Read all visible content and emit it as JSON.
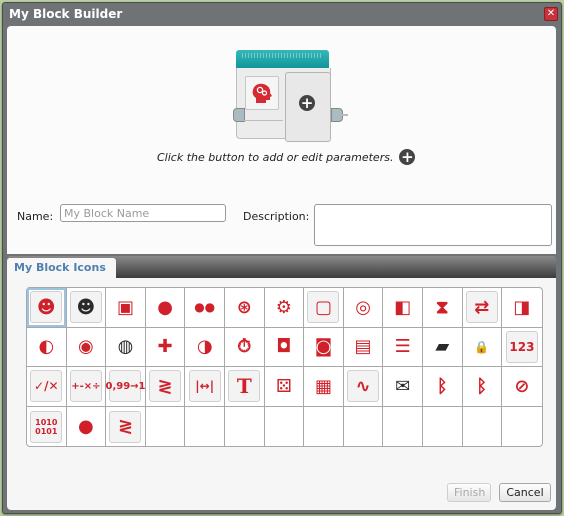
{
  "window": {
    "title": "My Block Builder",
    "close_icon": "close-icon"
  },
  "preview": {
    "instruction": "Click the button to add or edit parameters.",
    "add_icon": "+"
  },
  "form": {
    "name_label": "Name:",
    "name_value": "",
    "name_placeholder": "My Block Name",
    "description_label": "Description:",
    "description_value": ""
  },
  "tabs": [
    {
      "label": "My Block Icons",
      "active": true
    }
  ],
  "icon_grid": {
    "columns": 13,
    "rows": 4,
    "selected_index": 0,
    "icons": [
      {
        "name": "head-gears-red-icon",
        "glyph": "☻"
      },
      {
        "name": "head-gears-black-icon",
        "glyph": "☻"
      },
      {
        "name": "large-motor-icon",
        "glyph": "▣"
      },
      {
        "name": "medium-motor-icon",
        "glyph": "●"
      },
      {
        "name": "move-tank-icon",
        "glyph": "●●"
      },
      {
        "name": "move-steering-icon",
        "glyph": "⊛"
      },
      {
        "name": "motor-settings-icon",
        "glyph": "⚙"
      },
      {
        "name": "display-icon",
        "glyph": "▢"
      },
      {
        "name": "sound-icon",
        "glyph": "◎"
      },
      {
        "name": "brick-status-light-icon",
        "glyph": "◧"
      },
      {
        "name": "wait-hourglass-icon",
        "glyph": "⧗"
      },
      {
        "name": "loop-interrupt-icon",
        "glyph": "⇄"
      },
      {
        "name": "brick-port-icon",
        "glyph": "◨"
      },
      {
        "name": "color-sensor-icon",
        "glyph": "◐"
      },
      {
        "name": "gyro-sensor-icon",
        "glyph": "◉"
      },
      {
        "name": "infrared-sensor-icon",
        "glyph": "◍"
      },
      {
        "name": "brick-buttons-icon",
        "glyph": "✚"
      },
      {
        "name": "motor-rotation-icon",
        "glyph": "◑"
      },
      {
        "name": "timer-icon",
        "glyph": "⏱"
      },
      {
        "name": "touch-sensor-icon",
        "glyph": "◘"
      },
      {
        "name": "ultrasonic-sensor-icon",
        "glyph": "◙"
      },
      {
        "name": "energy-meter-icon",
        "glyph": "▤"
      },
      {
        "name": "file-access-icon",
        "glyph": "☰"
      },
      {
        "name": "case-icon",
        "glyph": "▰"
      },
      {
        "name": "locked-case-icon",
        "glyph": "🔒"
      },
      {
        "name": "array-icon",
        "glyph": "123"
      },
      {
        "name": "logic-operations-icon",
        "glyph": "✓/✕"
      },
      {
        "name": "math-icon",
        "glyph": "+-×÷"
      },
      {
        "name": "round-icon",
        "glyph": "0,99→1"
      },
      {
        "name": "compare-icon",
        "glyph": "≷"
      },
      {
        "name": "range-icon",
        "glyph": "|↔|"
      },
      {
        "name": "text-icon",
        "glyph": "T"
      },
      {
        "name": "random-icon",
        "glyph": "⚄"
      },
      {
        "name": "data-logging-icon",
        "glyph": "▦"
      },
      {
        "name": "sensor-display-icon",
        "glyph": "∿"
      },
      {
        "name": "messaging-icon",
        "glyph": "✉"
      },
      {
        "name": "bluetooth-icon",
        "glyph": "ᛒ"
      },
      {
        "name": "bluetooth-settings-icon",
        "glyph": "ᛒ"
      },
      {
        "name": "stop-icon",
        "glyph": "⊘"
      },
      {
        "name": "binary-icon",
        "glyph": "1010 0101"
      },
      {
        "name": "invert-motor-icon",
        "glyph": "●"
      },
      {
        "name": "compare-alt-icon",
        "glyph": "≷"
      }
    ]
  },
  "buttons": {
    "finish_label": "Finish",
    "finish_enabled": false,
    "cancel_label": "Cancel"
  },
  "colors": {
    "title_bar": "#6f7375",
    "block_accent": "#1aa3a6",
    "icon_red": "#d0202a",
    "tab_text": "#5080b0"
  }
}
